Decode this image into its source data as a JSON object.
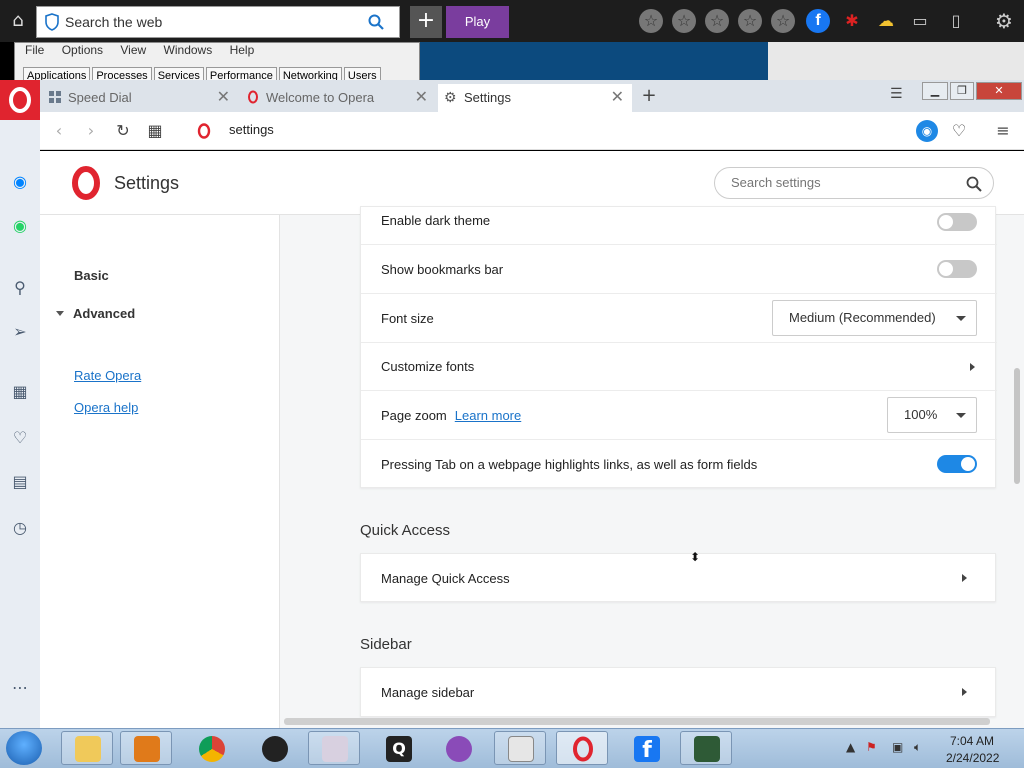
{
  "launcher": {
    "search_text": "Search the web",
    "play_label": "Play",
    "plus_label": "+"
  },
  "bg_window": {
    "menu": [
      "File",
      "Options",
      "View",
      "Windows",
      "Help"
    ],
    "tabs": [
      "Applications",
      "Processes",
      "Services",
      "Performance",
      "Networking",
      "Users"
    ]
  },
  "browser": {
    "tabs": [
      {
        "label": "Speed Dial",
        "icon": "grid-icon"
      },
      {
        "label": "Welcome to Opera",
        "icon": "opera-icon"
      },
      {
        "label": "Settings",
        "icon": "gear-icon"
      }
    ],
    "address": "settings"
  },
  "settings": {
    "title": "Settings",
    "search_placeholder": "Search settings",
    "nav": {
      "basic": "Basic",
      "advanced": "Advanced",
      "rate": "Rate Opera",
      "help": "Opera help"
    },
    "appearance_rows": {
      "dark_theme": "Enable dark theme",
      "bookmarks_bar": "Show bookmarks bar",
      "font_size": "Font size",
      "font_size_value": "Medium (Recommended)",
      "customize_fonts": "Customize fonts",
      "page_zoom": "Page zoom",
      "learn_more": "Learn more",
      "page_zoom_value": "100%",
      "tab_highlight": "Pressing Tab on a webpage highlights links, as well as form fields"
    },
    "toggles": {
      "dark_theme": false,
      "bookmarks_bar": false,
      "tab_highlight": true
    },
    "quick_access": {
      "title": "Quick Access",
      "manage": "Manage Quick Access"
    },
    "sidebar_section": {
      "title": "Sidebar",
      "manage": "Manage sidebar"
    }
  },
  "taskbar": {
    "time": "7:04 AM",
    "date": "2/24/2022"
  },
  "colors": {
    "opera_red": "#e0242f",
    "accent_blue": "#1e88e5",
    "play_purple": "#7a3d9e"
  }
}
